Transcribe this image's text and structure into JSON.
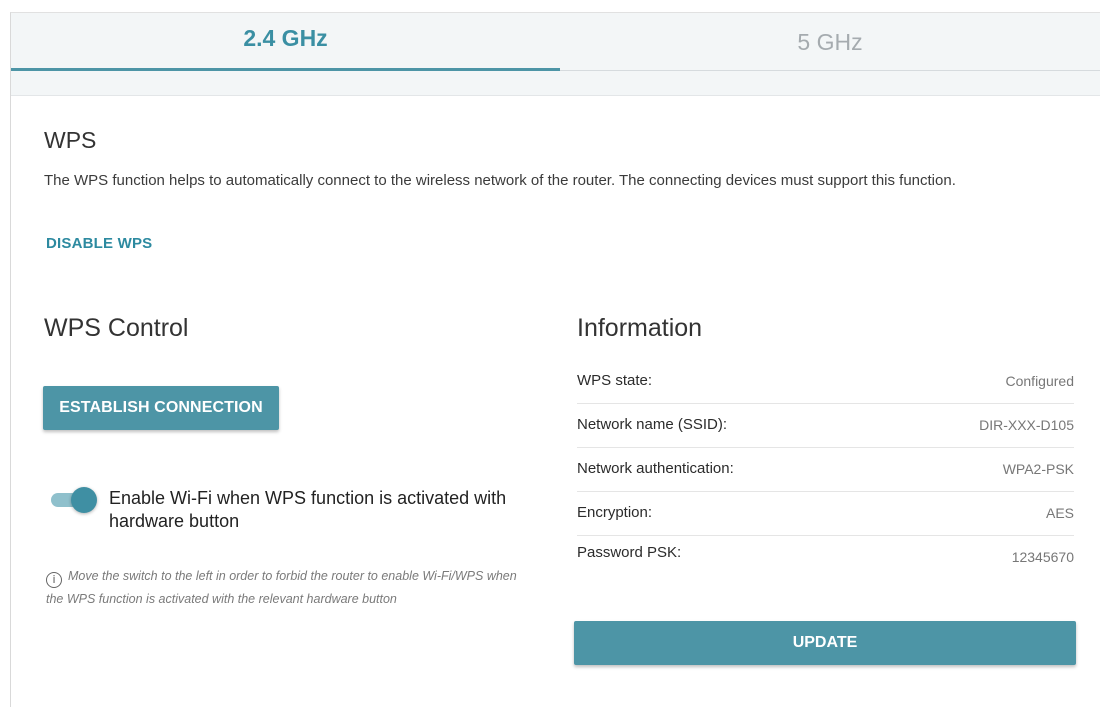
{
  "tabs": [
    {
      "label": "2.4 GHz",
      "active": true
    },
    {
      "label": "5 GHz",
      "active": false
    }
  ],
  "wps": {
    "title": "WPS",
    "description": "The WPS function helps to automatically connect to the wireless network of the router. The connecting devices must support this function.",
    "disable_label": "DISABLE WPS"
  },
  "control": {
    "title": "WPS Control",
    "establish_label": "ESTABLISH CONNECTION",
    "toggle_on": true,
    "toggle_label": "Enable Wi-Fi when WPS function is activated with hardware button",
    "note": "Move the switch to the left in order to forbid the router to enable Wi-Fi/WPS when the WPS function is activated with the relevant hardware button"
  },
  "information": {
    "title": "Information",
    "rows": [
      {
        "label": "WPS state:",
        "value": "Configured"
      },
      {
        "label": "Network name (SSID):",
        "value": "DIR-XXX-D105"
      },
      {
        "label": "Network authentication:",
        "value": "WPA2-PSK"
      },
      {
        "label": "Encryption:",
        "value": "AES"
      },
      {
        "label": "Password PSK:",
        "value": "12345670"
      }
    ],
    "update_label": "UPDATE"
  },
  "colors": {
    "accent": "#4d95a6",
    "link": "#2d8aa0",
    "tab_inactive": "#a5abaf"
  }
}
